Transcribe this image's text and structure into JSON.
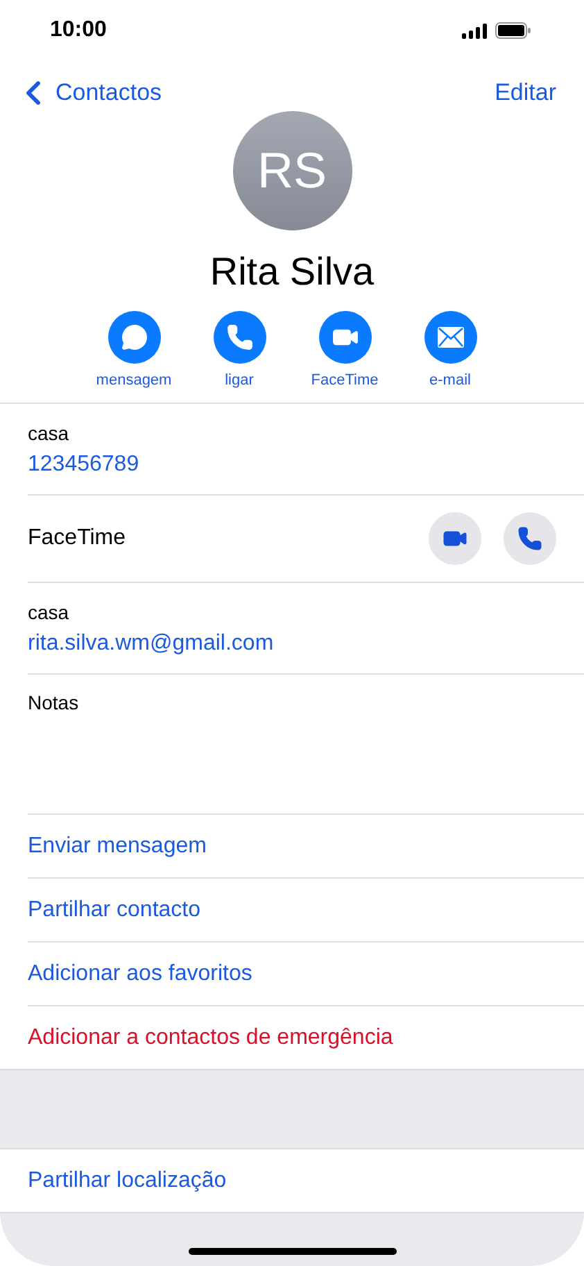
{
  "status_bar": {
    "time": "10:00"
  },
  "nav": {
    "back": "Contactos",
    "edit": "Editar"
  },
  "contact": {
    "initials": "RS",
    "name": "Rita Silva"
  },
  "quick_actions": [
    {
      "kind": "message",
      "label": "mensagem"
    },
    {
      "kind": "call",
      "label": "ligar"
    },
    {
      "kind": "video",
      "label": "FaceTime"
    },
    {
      "kind": "mail",
      "label": "e-mail"
    }
  ],
  "fields": [
    {
      "kind": "value",
      "label": "casa",
      "value": "123456789"
    },
    {
      "kind": "facetime",
      "label": "FaceTime",
      "buttons": [
        {
          "kind": "video"
        },
        {
          "kind": "call"
        }
      ]
    },
    {
      "kind": "value",
      "label": "casa",
      "value": "rita.silva.wm@gmail.com"
    },
    {
      "kind": "notes",
      "label": "Notas"
    }
  ],
  "actions": [
    {
      "label": "Enviar mensagem",
      "kind": "normal"
    },
    {
      "label": "Partilhar contacto",
      "kind": "normal"
    },
    {
      "label": "Adicionar aos favoritos",
      "kind": "normal"
    },
    {
      "label": "Adicionar a contactos de emergência",
      "kind": "danger"
    }
  ],
  "location_action": {
    "label": "Partilhar localização"
  }
}
